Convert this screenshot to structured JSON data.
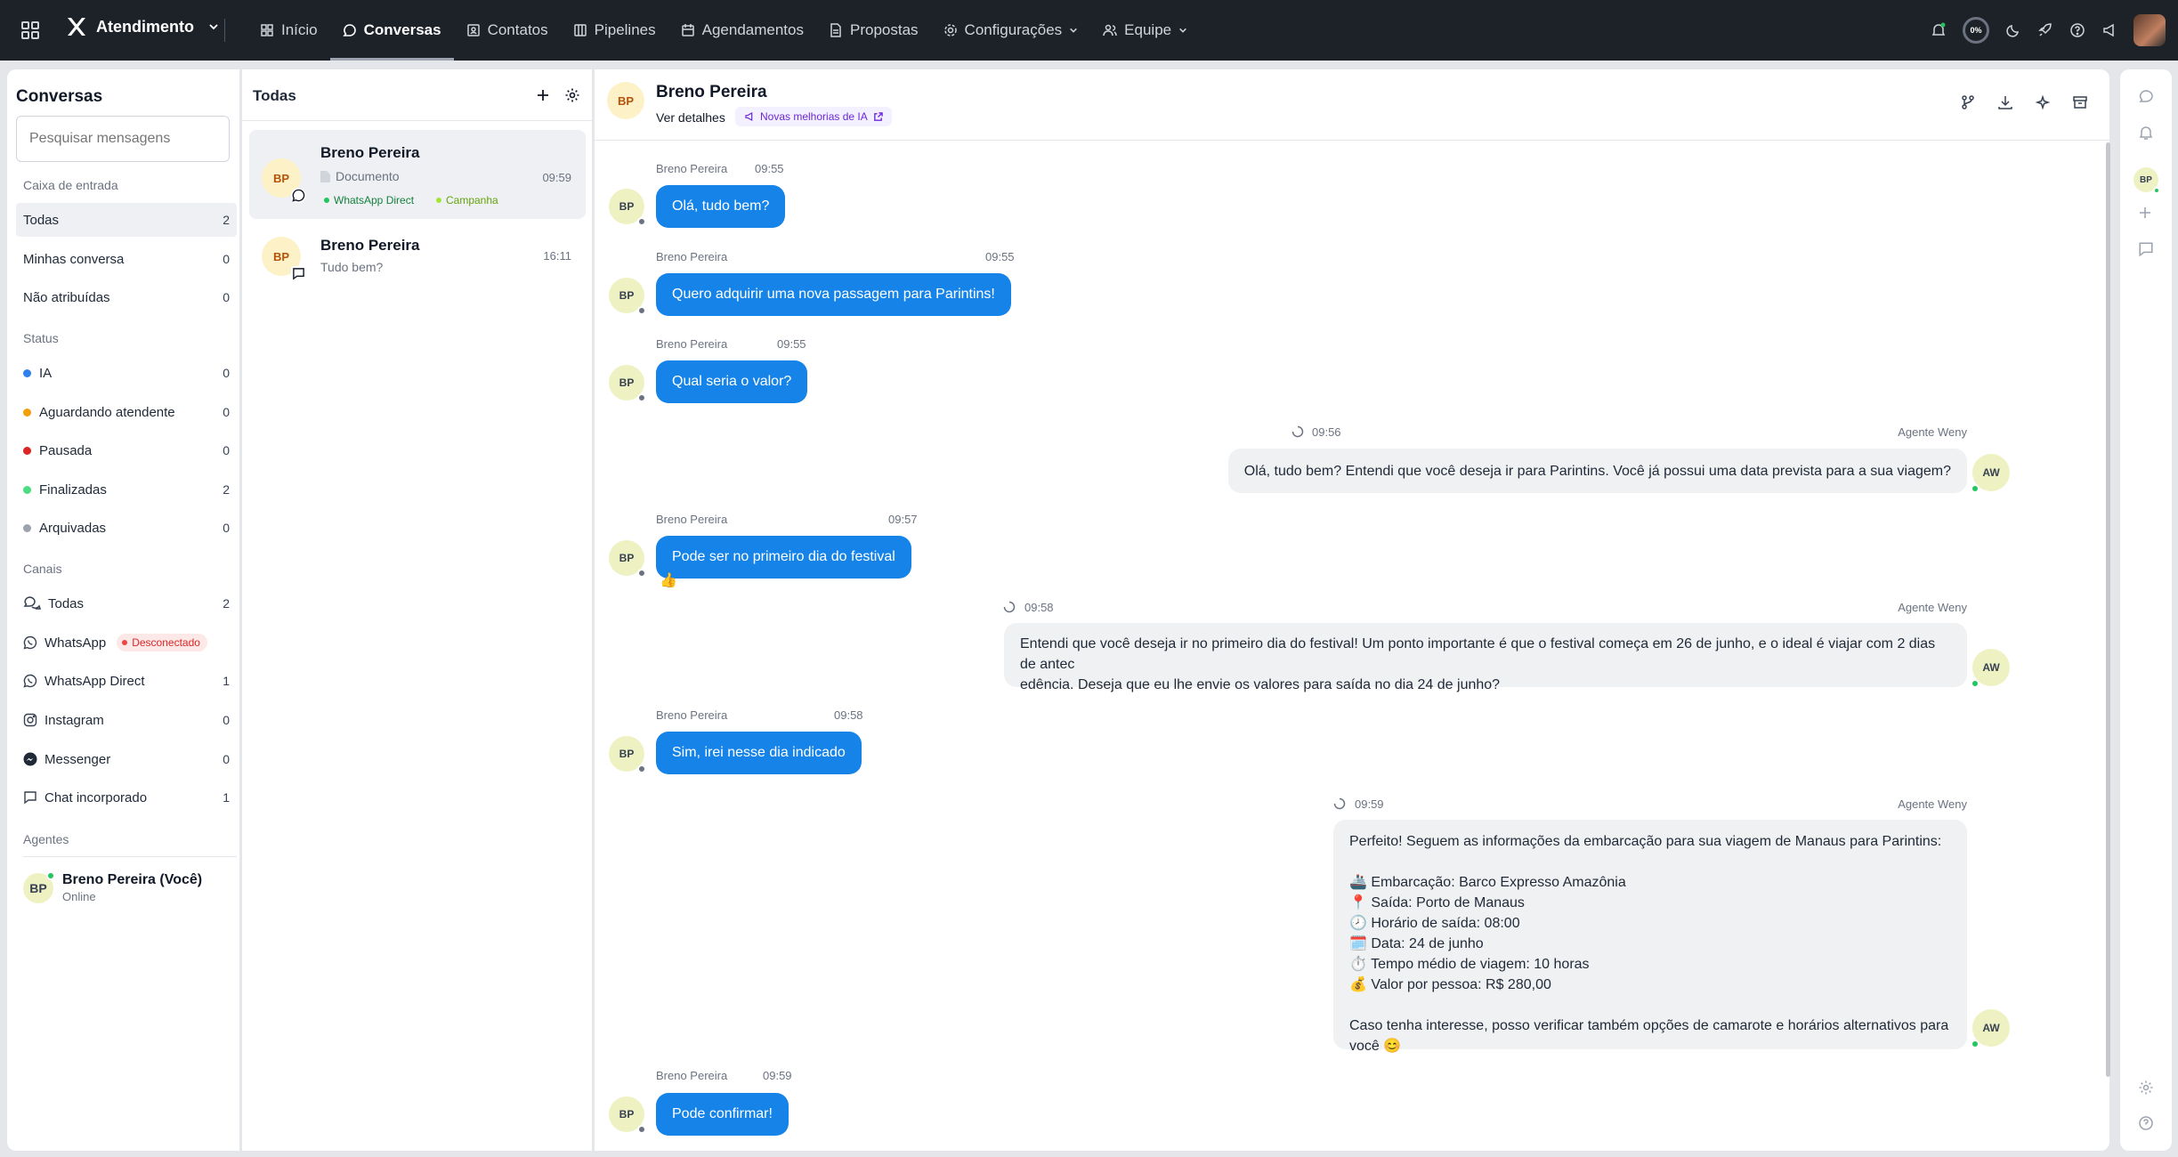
{
  "topbar": {
    "app_name": "Atendimento",
    "nav": [
      {
        "label": "Início",
        "icon": "dashboard-icon"
      },
      {
        "label": "Conversas",
        "icon": "chat-icon",
        "active": true
      },
      {
        "label": "Contatos",
        "icon": "contacts-icon"
      },
      {
        "label": "Pipelines",
        "icon": "pipeline-icon"
      },
      {
        "label": "Agendamentos",
        "icon": "calendar-icon"
      },
      {
        "label": "Propostas",
        "icon": "document-icon"
      },
      {
        "label": "Configurações",
        "icon": "gear-icon",
        "dropdown": true
      },
      {
        "label": "Equipe",
        "icon": "users-icon",
        "dropdown": true
      }
    ],
    "progress_label": "0%"
  },
  "sidebar": {
    "title": "Conversas",
    "search_placeholder": "Pesquisar mensagens",
    "inbox_heading": "Caixa de entrada",
    "inbox": [
      {
        "label": "Todas",
        "count": "2",
        "active": true
      },
      {
        "label": "Minhas conversa",
        "count": "0"
      },
      {
        "label": "Não atribuídas",
        "count": "0"
      }
    ],
    "status_heading": "Status",
    "status": [
      {
        "label": "IA",
        "count": "0",
        "color": "#2f80ed"
      },
      {
        "label": "Aguardando atendente",
        "count": "0",
        "color": "#f59e0b"
      },
      {
        "label": "Pausada",
        "count": "0",
        "color": "#dc2626"
      },
      {
        "label": "Finalizadas",
        "count": "2",
        "color": "#4ade80"
      },
      {
        "label": "Arquivadas",
        "count": "0",
        "color": "#9ca3af"
      }
    ],
    "channels_heading": "Canais",
    "channels": [
      {
        "label": "Todas",
        "count": "2",
        "icon": "chats-icon"
      },
      {
        "label": "WhatsApp",
        "badge": "Desconectado",
        "icon": "whatsapp-icon"
      },
      {
        "label": "WhatsApp Direct",
        "count": "1",
        "icon": "whatsapp-icon"
      },
      {
        "label": "Instagram",
        "count": "0",
        "icon": "instagram-icon"
      },
      {
        "label": "Messenger",
        "count": "0",
        "icon": "messenger-icon"
      },
      {
        "label": "Chat incorporado",
        "count": "1",
        "icon": "message-square-icon"
      }
    ],
    "agents_heading": "Agentes",
    "agent": {
      "initials": "BP",
      "name": "Breno Pereira (Você)",
      "status": "Online"
    }
  },
  "conversation_list": {
    "title": "Todas",
    "items": [
      {
        "initials": "BP",
        "name": "Breno Pereira",
        "preview": "Documento",
        "time": "09:59",
        "tags": [
          "WhatsApp Direct",
          "Campanha"
        ]
      },
      {
        "initials": "BP",
        "name": "Breno Pereira",
        "preview": "Tudo bem?",
        "time": "16:11"
      }
    ]
  },
  "chat": {
    "contact_name": "Breno Pereira",
    "details_link": "Ver detalhes",
    "ai_badge": "Novas melhorias de IA",
    "contact_initials": "BP",
    "agent_initials": "AW",
    "messages": [
      {
        "dir": "in",
        "sender": "Breno Pereira",
        "time": "09:55",
        "text": "Olá, tudo bem?"
      },
      {
        "dir": "in",
        "sender": "Breno Pereira",
        "time": "09:55",
        "text": "Quero adquirir uma nova passagem para Parintins!"
      },
      {
        "dir": "in",
        "sender": "Breno Pereira",
        "time": "09:55",
        "text": "Qual seria o valor?"
      },
      {
        "dir": "out",
        "sender": "Agente Weny",
        "time": "09:56",
        "text": "Olá, tudo bem? Entendi que você deseja ir para Parintins. Você já possui uma data prevista para a sua viagem?"
      },
      {
        "dir": "in",
        "sender": "Breno Pereira",
        "time": "09:57",
        "text": "Pode ser no primeiro dia do festival",
        "reaction": "👍"
      },
      {
        "dir": "out",
        "sender": "Agente Weny",
        "time": "09:58",
        "text": "Entendi que você deseja ir no primeiro dia do festival! Um ponto importante é que o festival começa em 26 de junho, e o ideal é viajar com 2 dias de antec\nedência. Deseja que eu lhe envie os valores para saída no dia 24 de junho?"
      },
      {
        "dir": "in",
        "sender": "Breno Pereira",
        "time": "09:58",
        "text": "Sim, irei nesse dia indicado"
      },
      {
        "dir": "out",
        "sender": "Agente Weny",
        "time": "09:59",
        "text": "Perfeito! Seguem as informações da embarcação para sua viagem de Manaus para Parintins:\n\n🚢 Embarcação: Barco Expresso Amazônia\n📍 Saída: Porto de Manaus\n🕗 Horário de saída: 08:00\n🗓️ Data: 24 de junho\n⏱️ Tempo médio de viagem: 10 horas\n💰 Valor por pessoa: R$ 280,00\n\nCaso tenha interesse, posso verificar também opções de camarote e horários alternativos para você 😊"
      },
      {
        "dir": "in",
        "sender": "Breno Pereira",
        "time": "09:59",
        "text": "Pode confirmar!"
      }
    ]
  },
  "colors": {
    "topbar": "#1d2228",
    "bubble_in": "#1683e8",
    "bubble_out": "#f0f1f3",
    "online": "#22c55e"
  }
}
